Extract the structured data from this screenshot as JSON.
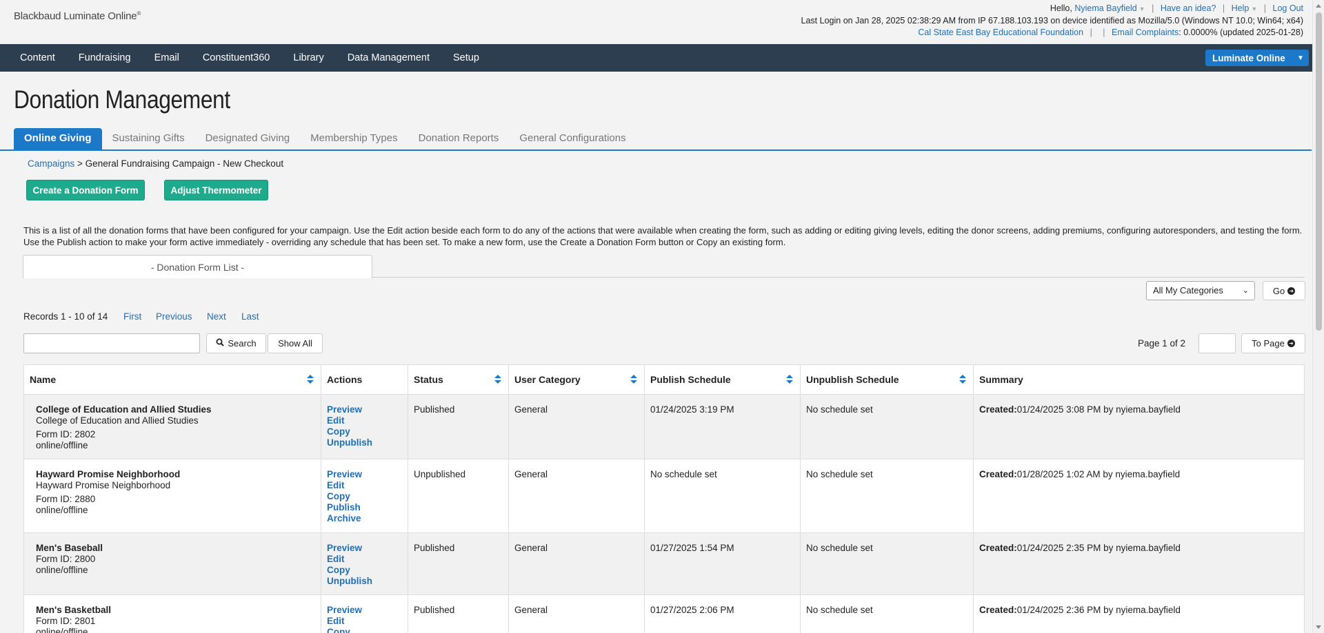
{
  "header": {
    "logo": "Blackbaud Luminate Online",
    "logo_mark": "®",
    "hello": "Hello,",
    "user": "Nyiema Bayfield",
    "idea": "Have an idea?",
    "help": "Help",
    "logout": "Log Out",
    "last_login": "Last Login on Jan 28, 2025 02:38:29 AM from IP 67.188.103.193 on device identified as Mozilla/5.0 (Windows NT 10.0; Win64; x64)",
    "org": "Cal State East Bay Educational Foundation",
    "sep": "|",
    "complaints_label": "Email Complaints",
    "complaints_value": ": 0.0000% (updated 2025-01-28)"
  },
  "nav": {
    "items": [
      "Content",
      "Fundraising",
      "Email",
      "Constituent360",
      "Library",
      "Data Management",
      "Setup"
    ],
    "product": "Luminate Online"
  },
  "page": {
    "title": "Donation Management",
    "tabs": [
      "Online Giving",
      "Sustaining Gifts",
      "Designated Giving",
      "Membership Types",
      "Donation Reports",
      "General Configurations"
    ],
    "breadcrumb_link": "Campaigns",
    "breadcrumb_rest": " > General Fundraising Campaign - New Checkout",
    "create_btn": "Create a Donation Form",
    "thermo_btn": "Adjust Thermometer",
    "description": "This is a list of all the donation forms that have been configured for your campaign. Use the Edit action beside each form to do any of the actions that were available when creating the form, such as adding or editing giving levels, editing the donor screens, adding premiums, configuring autoresponders, and testing the form. Use the Publish action to make your form active immediately - overriding any schedule that has been set. To make a new form, use the Create a Donation Form button or Copy an existing form.",
    "subtab": "- Donation Form List -",
    "category_select": "All My Categories",
    "go": "Go",
    "records": "Records 1 - 10 of 14",
    "first": "First",
    "previous": "Previous",
    "next": "Next",
    "last": "Last",
    "search": "Search",
    "show_all": "Show All",
    "page_info": "Page 1 of 2",
    "to_page": "To Page"
  },
  "table": {
    "headers": [
      "Name",
      "Actions",
      "Status",
      "User Category",
      "Publish Schedule",
      "Unpublish Schedule",
      "Summary"
    ],
    "created_label": "Created:",
    "rows": [
      {
        "name": "College of Education and Allied Studies",
        "sub": "College of Education and Allied Studies",
        "form_id": "Form ID: 2802",
        "mode": "online/offline",
        "actions": [
          "Preview",
          "Edit",
          "Copy",
          "Unpublish"
        ],
        "status": "Published",
        "category": "General",
        "publish": "01/24/2025 3:19 PM",
        "unpublish": "No schedule set",
        "created": "01/24/2025 3:08 PM by nyiema.bayfield"
      },
      {
        "name": "Hayward Promise Neighborhood",
        "sub": "Hayward Promise Neighborhood",
        "form_id": "Form ID: 2880",
        "mode": "online/offline",
        "actions": [
          "Preview",
          "Edit",
          "Copy",
          "Publish",
          "Archive"
        ],
        "status": "Unpublished",
        "category": "General",
        "publish": "No schedule set",
        "unpublish": "No schedule set",
        "created": "01/28/2025 1:02 AM by nyiema.bayfield"
      },
      {
        "name": "Men's Baseball",
        "sub": "",
        "form_id": "Form ID: 2800",
        "mode": "online/offline",
        "actions": [
          "Preview",
          "Edit",
          "Copy",
          "Unpublish"
        ],
        "status": "Published",
        "category": "General",
        "publish": "01/27/2025 1:54 PM",
        "unpublish": "No schedule set",
        "created": "01/24/2025 2:35 PM by nyiema.bayfield"
      },
      {
        "name": "Men's Basketball",
        "sub": "",
        "form_id": "Form ID: 2801",
        "mode": "online/offline",
        "actions": [
          "Preview",
          "Edit",
          "Copy"
        ],
        "status": "Published",
        "category": "General",
        "publish": "01/27/2025 2:06 PM",
        "unpublish": "No schedule set",
        "created": "01/24/2025 2:36 PM by nyiema.bayfield"
      }
    ]
  }
}
